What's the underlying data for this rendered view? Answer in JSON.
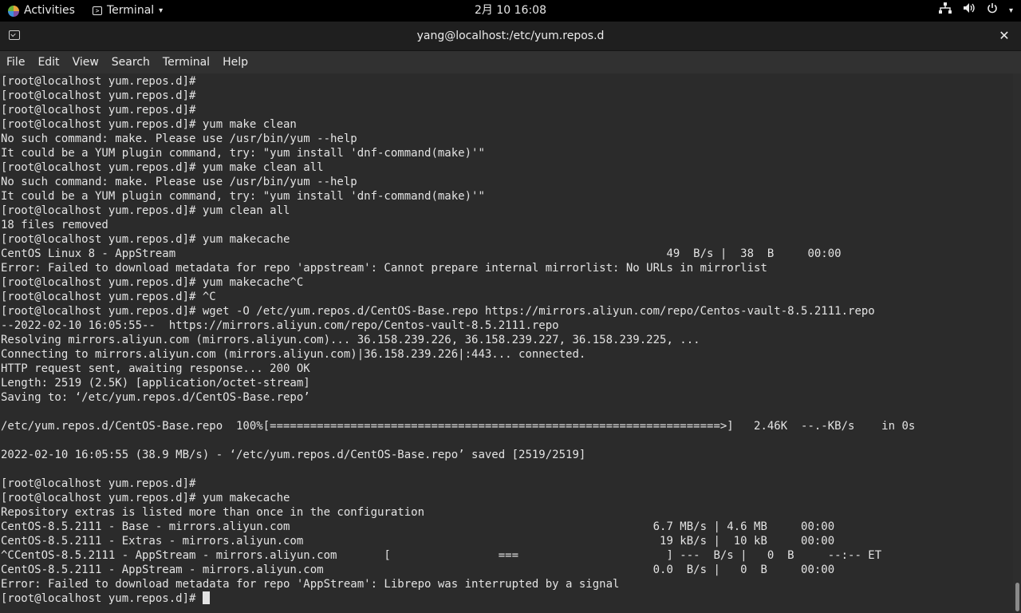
{
  "topbar": {
    "activities_label": "Activities",
    "app_menu_label": "Terminal",
    "clock": "2月 10 16:08",
    "tray_icons": [
      "network-icon",
      "volume-icon",
      "power-icon",
      "chevron-down-icon"
    ]
  },
  "window": {
    "title": "yang@localhost:/etc/yum.repos.d",
    "close_glyph": "✕"
  },
  "menu": {
    "items": [
      "File",
      "Edit",
      "View",
      "Search",
      "Terminal",
      "Help"
    ]
  },
  "terminal": {
    "lines": [
      "[root@localhost yum.repos.d]#",
      "[root@localhost yum.repos.d]#",
      "[root@localhost yum.repos.d]#",
      "[root@localhost yum.repos.d]# yum make clean",
      "No such command: make. Please use /usr/bin/yum --help",
      "It could be a YUM plugin command, try: \"yum install 'dnf-command(make)'\"",
      "[root@localhost yum.repos.d]# yum make clean all",
      "No such command: make. Please use /usr/bin/yum --help",
      "It could be a YUM plugin command, try: \"yum install 'dnf-command(make)'\"",
      "[root@localhost yum.repos.d]# yum clean all",
      "18 files removed",
      "[root@localhost yum.repos.d]# yum makecache",
      "CentOS Linux 8 - AppStream                                                                         49  B/s |  38  B     00:00",
      "Error: Failed to download metadata for repo 'appstream': Cannot prepare internal mirrorlist: No URLs in mirrorlist",
      "[root@localhost yum.repos.d]# yum makecache^C",
      "[root@localhost yum.repos.d]# ^C",
      "[root@localhost yum.repos.d]# wget -O /etc/yum.repos.d/CentOS-Base.repo https://mirrors.aliyun.com/repo/Centos-vault-8.5.2111.repo",
      "--2022-02-10 16:05:55--  https://mirrors.aliyun.com/repo/Centos-vault-8.5.2111.repo",
      "Resolving mirrors.aliyun.com (mirrors.aliyun.com)... 36.158.239.226, 36.158.239.227, 36.158.239.225, ...",
      "Connecting to mirrors.aliyun.com (mirrors.aliyun.com)|36.158.239.226|:443... connected.",
      "HTTP request sent, awaiting response... 200 OK",
      "Length: 2519 (2.5K) [application/octet-stream]",
      "Saving to: ‘/etc/yum.repos.d/CentOS-Base.repo’",
      "",
      "/etc/yum.repos.d/CentOS-Base.repo  100%[===================================================================>]   2.46K  --.-KB/s    in 0s",
      "",
      "2022-02-10 16:05:55 (38.9 MB/s) - ‘/etc/yum.repos.d/CentOS-Base.repo’ saved [2519/2519]",
      "",
      "[root@localhost yum.repos.d]#",
      "[root@localhost yum.repos.d]# yum makecache",
      "Repository extras is listed more than once in the configuration",
      "CentOS-8.5.2111 - Base - mirrors.aliyun.com                                                      6.7 MB/s | 4.6 MB     00:00",
      "CentOS-8.5.2111 - Extras - mirrors.aliyun.com                                                     19 kB/s |  10 kB     00:00",
      "^CCentOS-8.5.2111 - AppStream - mirrors.aliyun.com       [                ===                      ] ---  B/s |   0  B     --:-- ET",
      "CentOS-8.5.2111 - AppStream - mirrors.aliyun.com                                                 0.0  B/s |   0  B     00:00",
      "Error: Failed to download metadata for repo 'AppStream': Librepo was interrupted by a signal"
    ],
    "prompt": "[root@localhost yum.repos.d]# "
  }
}
